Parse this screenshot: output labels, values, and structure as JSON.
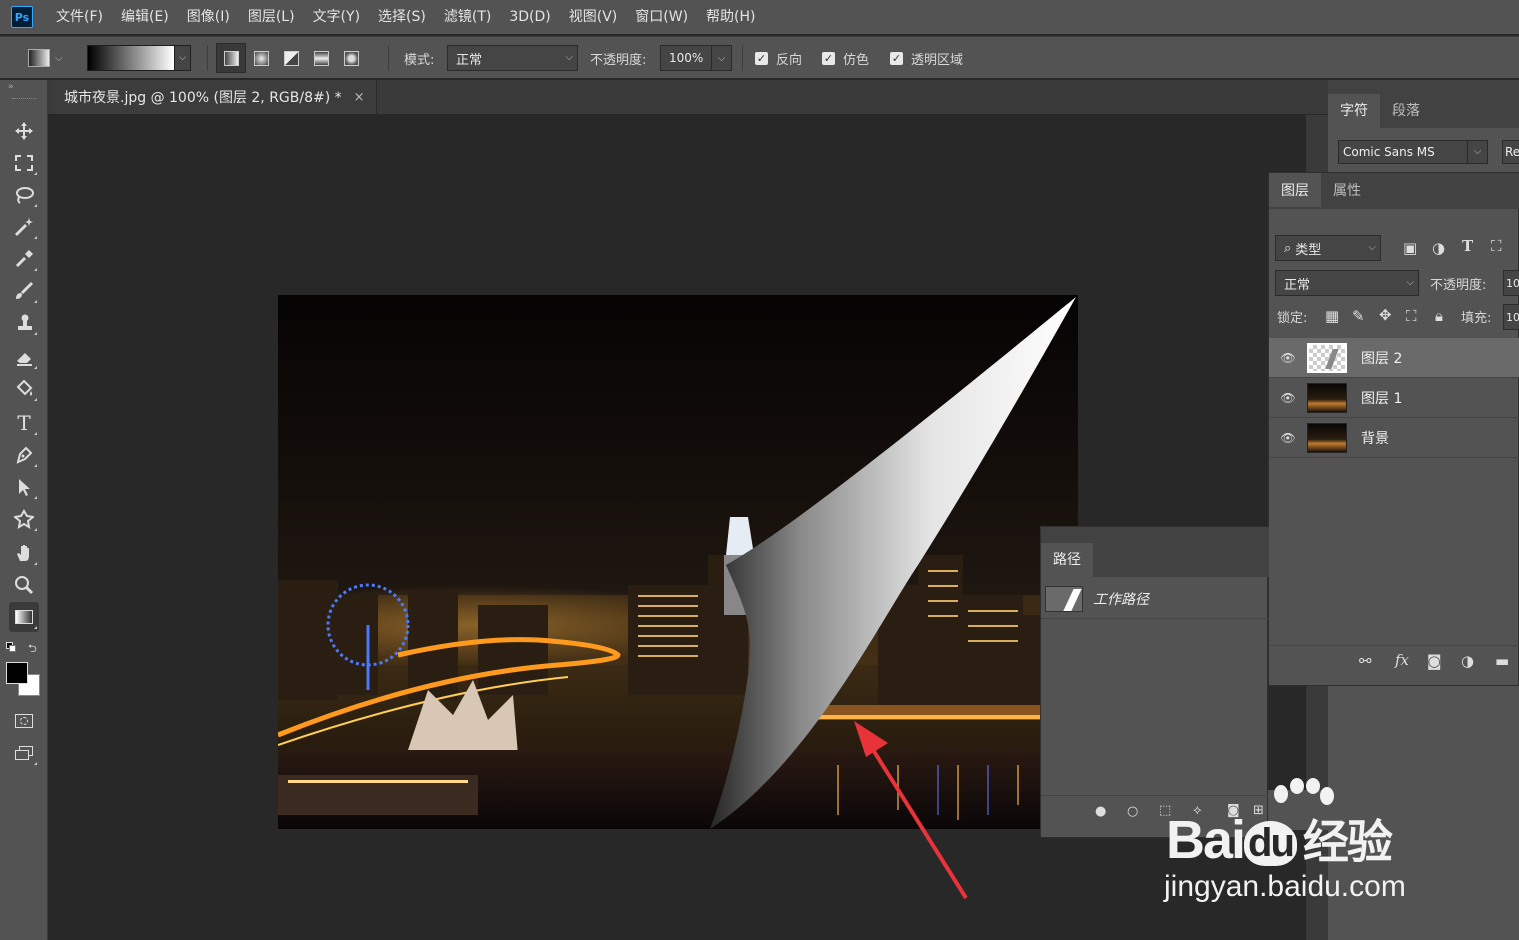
{
  "app": {
    "logo_text": "Ps"
  },
  "menu": [
    "文件(F)",
    "编辑(E)",
    "图像(I)",
    "图层(L)",
    "文字(Y)",
    "选择(S)",
    "滤镜(T)",
    "3D(D)",
    "视图(V)",
    "窗口(W)",
    "帮助(H)"
  ],
  "options": {
    "mode_label": "模式:",
    "mode_value": "正常",
    "opacity_label": "不透明度:",
    "opacity_value": "100%",
    "reverse_label": "反向",
    "dither_label": "仿色",
    "transparency_label": "透明区域"
  },
  "document": {
    "tab_title": "城市夜景.jpg @ 100% (图层 2, RGB/8#) *",
    "close_glyph": "×"
  },
  "character_panel": {
    "tabs": [
      "字符",
      "段落"
    ],
    "font_family": "Comic Sans MS",
    "font_style_partial": "Re"
  },
  "layers_panel": {
    "tabs": [
      "图层",
      "属性"
    ],
    "filter_label": "类型",
    "blend_mode": "正常",
    "opacity_label": "不透明度:",
    "opacity_value_partial": "10",
    "lock_label": "锁定:",
    "fill_label": "填充:",
    "fill_value_partial": "10",
    "layers": [
      {
        "name": "图层 2",
        "selected": true
      },
      {
        "name": "图层 1",
        "selected": false
      },
      {
        "name": "背景",
        "selected": false
      }
    ],
    "footer_fx": "fx"
  },
  "paths_panel": {
    "tab": "路径",
    "items": [
      {
        "name": "工作路径"
      }
    ]
  },
  "watermark": {
    "brand": "Bai",
    "brand2": "du",
    "text": "经验",
    "url": "jingyan.baidu.com"
  },
  "colors": {
    "ui_bg": "#535353",
    "canvas_bg": "#282828",
    "dark": "#3a3a3a",
    "annotation_arrow": "#e8333a",
    "ps_blue": "#31a8ff"
  }
}
